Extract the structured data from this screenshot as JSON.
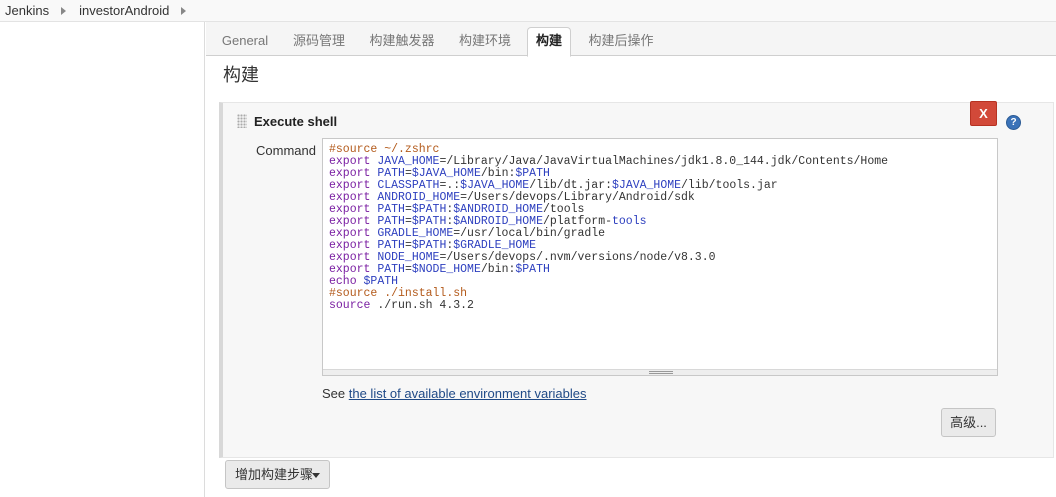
{
  "breadcrumb": {
    "items": [
      "Jenkins",
      "investorAndroid"
    ]
  },
  "tabs": [
    {
      "label": "General"
    },
    {
      "label": "源码管理"
    },
    {
      "label": "构建触发器"
    },
    {
      "label": "构建环境"
    },
    {
      "label": "构建",
      "active": true
    },
    {
      "label": "构建后操作"
    }
  ],
  "section": {
    "title": "构建"
  },
  "step": {
    "title": "Execute shell",
    "delete_label": "X",
    "help_label": "?",
    "command_label": "Command",
    "command_lines": [
      [
        {
          "t": "cm",
          "v": "#source ~/.zshrc"
        }
      ],
      [
        {
          "t": "kw",
          "v": "export"
        },
        {
          "t": "txt",
          "v": " "
        },
        {
          "t": "var",
          "v": "JAVA_HOME"
        },
        {
          "t": "txt",
          "v": "=/Library/Java/JavaVirtualMachines/jdk1.8.0_144.jdk/Contents/Home"
        }
      ],
      [
        {
          "t": "kw",
          "v": "export"
        },
        {
          "t": "txt",
          "v": " "
        },
        {
          "t": "var",
          "v": "PATH"
        },
        {
          "t": "txt",
          "v": "="
        },
        {
          "t": "var",
          "v": "$JAVA_HOME"
        },
        {
          "t": "txt",
          "v": "/bin:"
        },
        {
          "t": "var",
          "v": "$PATH"
        }
      ],
      [
        {
          "t": "kw",
          "v": "export"
        },
        {
          "t": "txt",
          "v": " "
        },
        {
          "t": "var",
          "v": "CLASSPATH"
        },
        {
          "t": "txt",
          "v": "=.:"
        },
        {
          "t": "var",
          "v": "$JAVA_HOME"
        },
        {
          "t": "txt",
          "v": "/lib/dt.jar:"
        },
        {
          "t": "var",
          "v": "$JAVA_HOME"
        },
        {
          "t": "txt",
          "v": "/lib/tools.jar"
        }
      ],
      [
        {
          "t": "kw",
          "v": "export"
        },
        {
          "t": "txt",
          "v": " "
        },
        {
          "t": "var",
          "v": "ANDROID_HOME"
        },
        {
          "t": "txt",
          "v": "=/Users/devops/Library/Android/sdk"
        }
      ],
      [
        {
          "t": "kw",
          "v": "export"
        },
        {
          "t": "txt",
          "v": " "
        },
        {
          "t": "var",
          "v": "PATH"
        },
        {
          "t": "txt",
          "v": "="
        },
        {
          "t": "var",
          "v": "$PATH"
        },
        {
          "t": "txt",
          "v": ":"
        },
        {
          "t": "var",
          "v": "$ANDROID_HOME"
        },
        {
          "t": "txt",
          "v": "/tools"
        }
      ],
      [
        {
          "t": "kw",
          "v": "export"
        },
        {
          "t": "txt",
          "v": " "
        },
        {
          "t": "var",
          "v": "PATH"
        },
        {
          "t": "txt",
          "v": "="
        },
        {
          "t": "var",
          "v": "$PATH"
        },
        {
          "t": "txt",
          "v": ":"
        },
        {
          "t": "var",
          "v": "$ANDROID_HOME"
        },
        {
          "t": "txt",
          "v": "/platform-"
        },
        {
          "t": "var",
          "v": "tools"
        }
      ],
      [
        {
          "t": "kw",
          "v": "export"
        },
        {
          "t": "txt",
          "v": " "
        },
        {
          "t": "var",
          "v": "GRADLE_HOME"
        },
        {
          "t": "txt",
          "v": "=/usr/local/bin/gradle"
        }
      ],
      [
        {
          "t": "kw",
          "v": "export"
        },
        {
          "t": "txt",
          "v": " "
        },
        {
          "t": "var",
          "v": "PATH"
        },
        {
          "t": "txt",
          "v": "="
        },
        {
          "t": "var",
          "v": "$PATH"
        },
        {
          "t": "txt",
          "v": ":"
        },
        {
          "t": "var",
          "v": "$GRADLE_HOME"
        }
      ],
      [
        {
          "t": "kw",
          "v": "export"
        },
        {
          "t": "txt",
          "v": " "
        },
        {
          "t": "var",
          "v": "NODE_HOME"
        },
        {
          "t": "txt",
          "v": "=/Users/devops/.nvm/versions/node/v8.3.0"
        }
      ],
      [
        {
          "t": "kw",
          "v": "export"
        },
        {
          "t": "txt",
          "v": " "
        },
        {
          "t": "var",
          "v": "PATH"
        },
        {
          "t": "txt",
          "v": "="
        },
        {
          "t": "var",
          "v": "$NODE_HOME"
        },
        {
          "t": "txt",
          "v": "/bin:"
        },
        {
          "t": "var",
          "v": "$PATH"
        }
      ],
      [
        {
          "t": "kw",
          "v": "echo"
        },
        {
          "t": "txt",
          "v": " "
        },
        {
          "t": "var",
          "v": "$PATH"
        }
      ],
      [
        {
          "t": "cm",
          "v": "#source ./install.sh"
        }
      ],
      [
        {
          "t": "kw",
          "v": "source"
        },
        {
          "t": "txt",
          "v": " ./run.sh 4.3.2"
        }
      ]
    ],
    "env_prefix": "See ",
    "env_link": "the list of available environment variables",
    "advanced_label": "高级..."
  },
  "add_step": {
    "label": "增加构建步骤"
  },
  "colors": {
    "keyword": "#7a1fa2",
    "variable": "#2d3fbf",
    "comment": "#b35a1b",
    "delete_button": "#d24939",
    "help_icon": "#3a72b8"
  }
}
